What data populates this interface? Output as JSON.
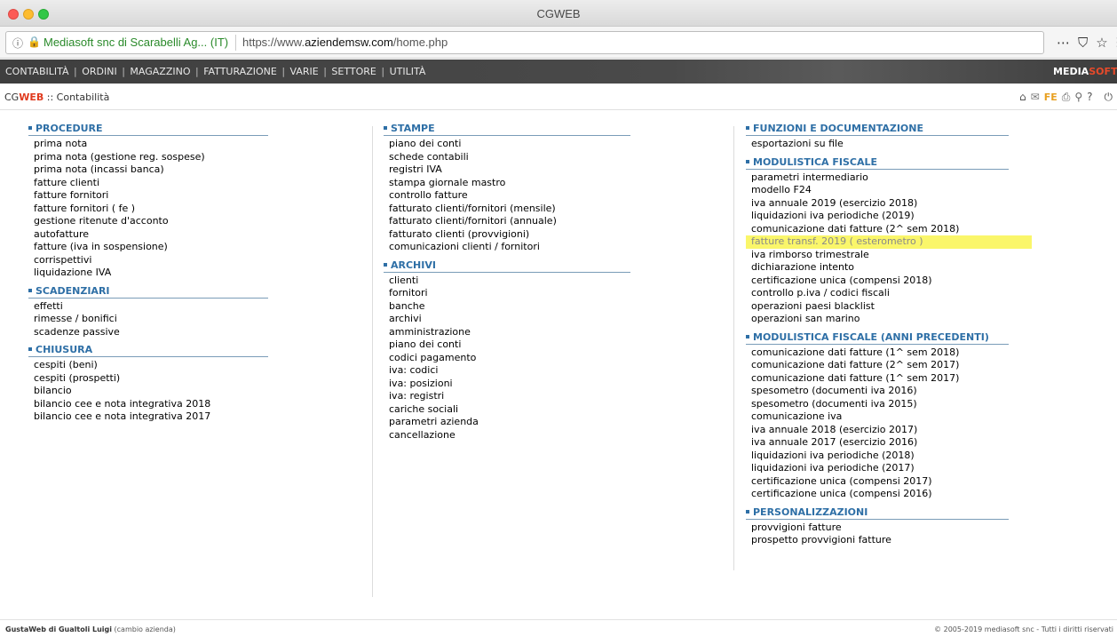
{
  "window": {
    "title": "CGWEB"
  },
  "browser": {
    "org": "Mediasoft snc di Scarabelli Ag... (IT)",
    "url_prefix": "https://www.",
    "url_domain": "aziendemsw.com",
    "url_path": "/home.php",
    "icons": [
      "more-icon",
      "pocket-icon",
      "star-icon",
      "menu-icon"
    ]
  },
  "menu": {
    "items": [
      "CONTABILITÀ",
      "ORDINI",
      "MAGAZZINO",
      "FATTURAZIONE",
      "VARIE",
      "SETTORE",
      "UTILITÀ"
    ],
    "brand_a": "MEDIA",
    "brand_b": "SOFT"
  },
  "breadcrumb": {
    "cg": "CG",
    "web": "WEB",
    "colons": " :: ",
    "page": "Contabilità"
  },
  "toolbar": {
    "fe": "FE",
    "help": "?"
  },
  "columns": [
    [
      {
        "title": "PROCEDURE",
        "items": [
          "prima nota",
          "prima nota (gestione reg. sospese)",
          "prima nota (incassi banca)",
          "fatture clienti",
          "fatture fornitori",
          "fatture fornitori ( fe )",
          "gestione ritenute d'acconto",
          "autofatture",
          "fatture (iva in sospensione)",
          "corrispettivi",
          "liquidazione IVA"
        ]
      },
      {
        "title": "SCADENZIARI",
        "items": [
          "effetti",
          "rimesse / bonifici",
          "scadenze passive"
        ]
      },
      {
        "title": "CHIUSURA",
        "items": [
          "cespiti (beni)",
          "cespiti (prospetti)",
          "bilancio",
          "bilancio cee e nota integrativa 2018",
          "bilancio cee e nota integrativa 2017"
        ]
      }
    ],
    [
      {
        "title": "STAMPE",
        "items": [
          "piano dei conti",
          "schede contabili",
          "registri IVA",
          "stampa giornale mastro",
          "controllo fatture",
          "fatturato clienti/fornitori (mensile)",
          "fatturato clienti/fornitori (annuale)",
          "fatturato clienti (provvigioni)",
          "comunicazioni clienti / fornitori"
        ]
      },
      {
        "title": "ARCHIVI",
        "items": [
          "clienti",
          "fornitori",
          "banche",
          "archivi",
          "amministrazione",
          "piano dei conti",
          "codici pagamento",
          "iva: codici",
          "iva: posizioni",
          "iva: registri",
          "cariche sociali",
          "parametri azienda",
          "cancellazione"
        ]
      }
    ],
    [
      {
        "title": "FUNZIONI E DOCUMENTAZIONE",
        "items": [
          "esportazioni su file"
        ]
      },
      {
        "title": "MODULISTICA FISCALE",
        "items": [
          "parametri intermediario",
          "modello F24",
          "iva annuale 2019 (esercizio 2018)",
          "liquidazioni iva periodiche (2019)",
          "comunicazione dati fatture (2^ sem 2018)",
          "fatture transf. 2019 ( esterometro )",
          "iva rimborso trimestrale",
          "dichiarazione intento",
          "certificazione unica (compensi 2018)",
          "controllo p.iva / codici fiscali",
          "operazioni paesi blacklist",
          "operazioni san marino"
        ],
        "highlight_index": 5
      },
      {
        "title": "MODULISTICA FISCALE (ANNI PRECEDENTI)",
        "items": [
          "comunicazione dati fatture (1^ sem 2018)",
          "comunicazione dati fatture (2^ sem 2017)",
          "comunicazione dati fatture (1^ sem 2017)",
          "spesometro (documenti iva 2016)",
          "spesometro (documenti iva 2015)",
          "comunicazione iva",
          "iva annuale 2018 (esercizio 2017)",
          "iva annuale 2017 (esercizio 2016)",
          "liquidazioni iva periodiche (2018)",
          "liquidazioni iva periodiche (2017)",
          "certificazione unica (compensi 2017)",
          "certificazione unica (compensi 2016)"
        ]
      },
      {
        "title": "PERSONALIZZAZIONI",
        "items": [
          "provvigioni fatture",
          "prospetto provvigioni fatture"
        ]
      }
    ]
  ],
  "footer": {
    "company": "GustaWeb di Gualtoli Luigi",
    "change": "(cambio azienda)",
    "copyright": "© 2005-2019 mediasoft snc - Tutti i diritti riservati"
  }
}
